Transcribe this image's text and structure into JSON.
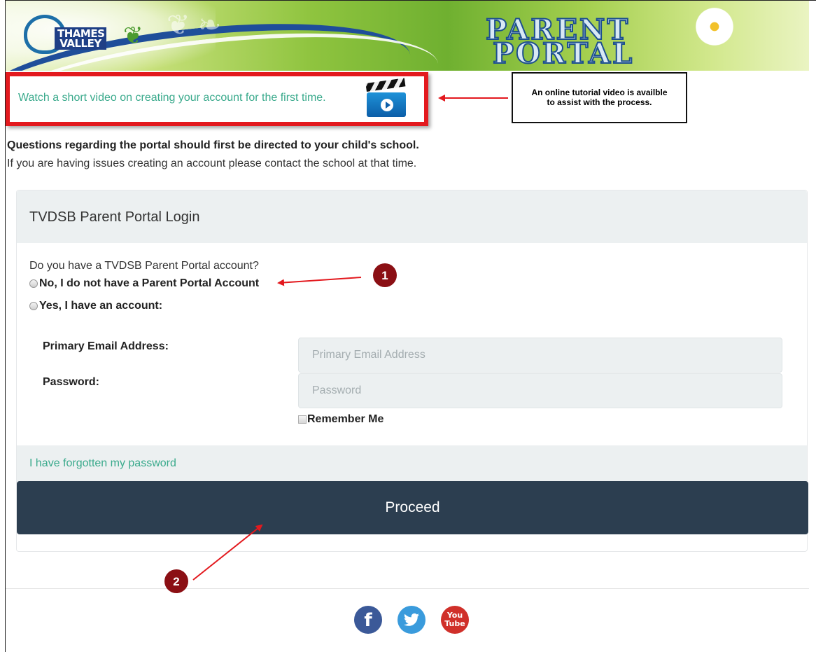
{
  "banner": {
    "logo_text": "THAMES VALLEY",
    "title_line1": "PARENT",
    "title_line2": "PORTAL"
  },
  "video": {
    "link_text": "Watch a short video on creating your account for the first time."
  },
  "callout": {
    "line1": "An online tutorial video is availble",
    "line2": "to assist with the process."
  },
  "intro": {
    "strong": "Questions regarding the portal should first be directed to your child's school.",
    "note": "If you are having issues creating an account please contact the school at that time."
  },
  "login": {
    "title": "TVDSB Parent Portal Login",
    "question": "Do you have a TVDSB Parent Portal account?",
    "option_no": "No, I do not have a Parent Portal Account",
    "option_yes": "Yes, I have an account:",
    "email_label": "Primary Email Address:",
    "email_placeholder": "Primary Email Address",
    "password_label": "Password:",
    "password_placeholder": "Password",
    "remember_label": "Remember Me",
    "forgot_link": "I have forgotten my password",
    "proceed_label": "Proceed"
  },
  "annotations": {
    "marker1": "1",
    "marker2": "2",
    "arrow_color": "#e3191e",
    "marker_color": "#8b0f14"
  },
  "footer": {
    "social": [
      {
        "name": "facebook",
        "glyph": "f"
      },
      {
        "name": "twitter",
        "glyph": "t"
      },
      {
        "name": "youtube",
        "glyph": "You\nTube"
      }
    ]
  },
  "colors": {
    "accent_link": "#3aaa8c",
    "button_bg": "#2c3e50",
    "panel_bg": "#ecf0f1",
    "highlight_border": "#e3191e"
  }
}
